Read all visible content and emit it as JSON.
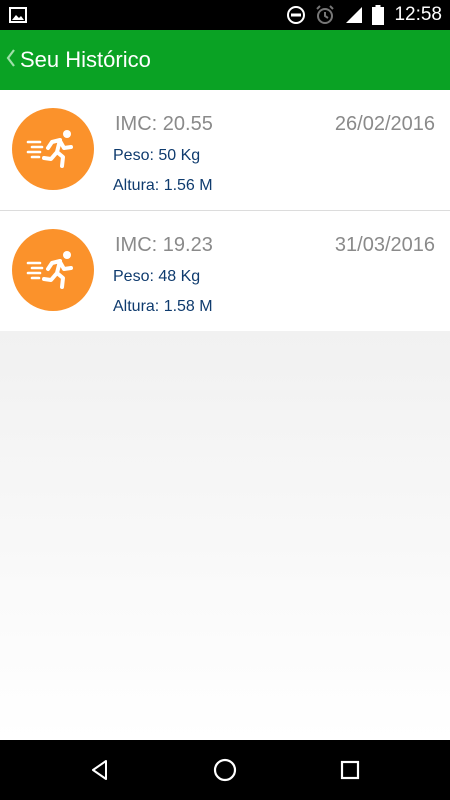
{
  "status_bar": {
    "time": "12:58",
    "icons": [
      "image-icon",
      "do-not-disturb-icon",
      "alarm-icon",
      "signal-icon",
      "battery-icon"
    ]
  },
  "app_bar": {
    "back_icon": "chevron-left-icon",
    "title": "Seu Histórico",
    "color": "#0aa224"
  },
  "history": [
    {
      "icon": "running-person-icon",
      "imc": "IMC: 20.55",
      "date": "26/02/2016",
      "peso": "Peso: 50 Kg",
      "altura": "Altura: 1.56 M"
    },
    {
      "icon": "running-person-icon",
      "imc": "IMC: 19.23",
      "date": "31/03/2016",
      "peso": "Peso: 48 Kg",
      "altura": "Altura: 1.58 M"
    }
  ],
  "colors": {
    "avatar": "#fb922b",
    "value_text": "#0f3b6e",
    "muted_text": "#8a8a8a"
  },
  "nav_bar": {
    "icons": [
      "back-triangle-icon",
      "home-circle-icon",
      "recents-square-icon"
    ]
  }
}
